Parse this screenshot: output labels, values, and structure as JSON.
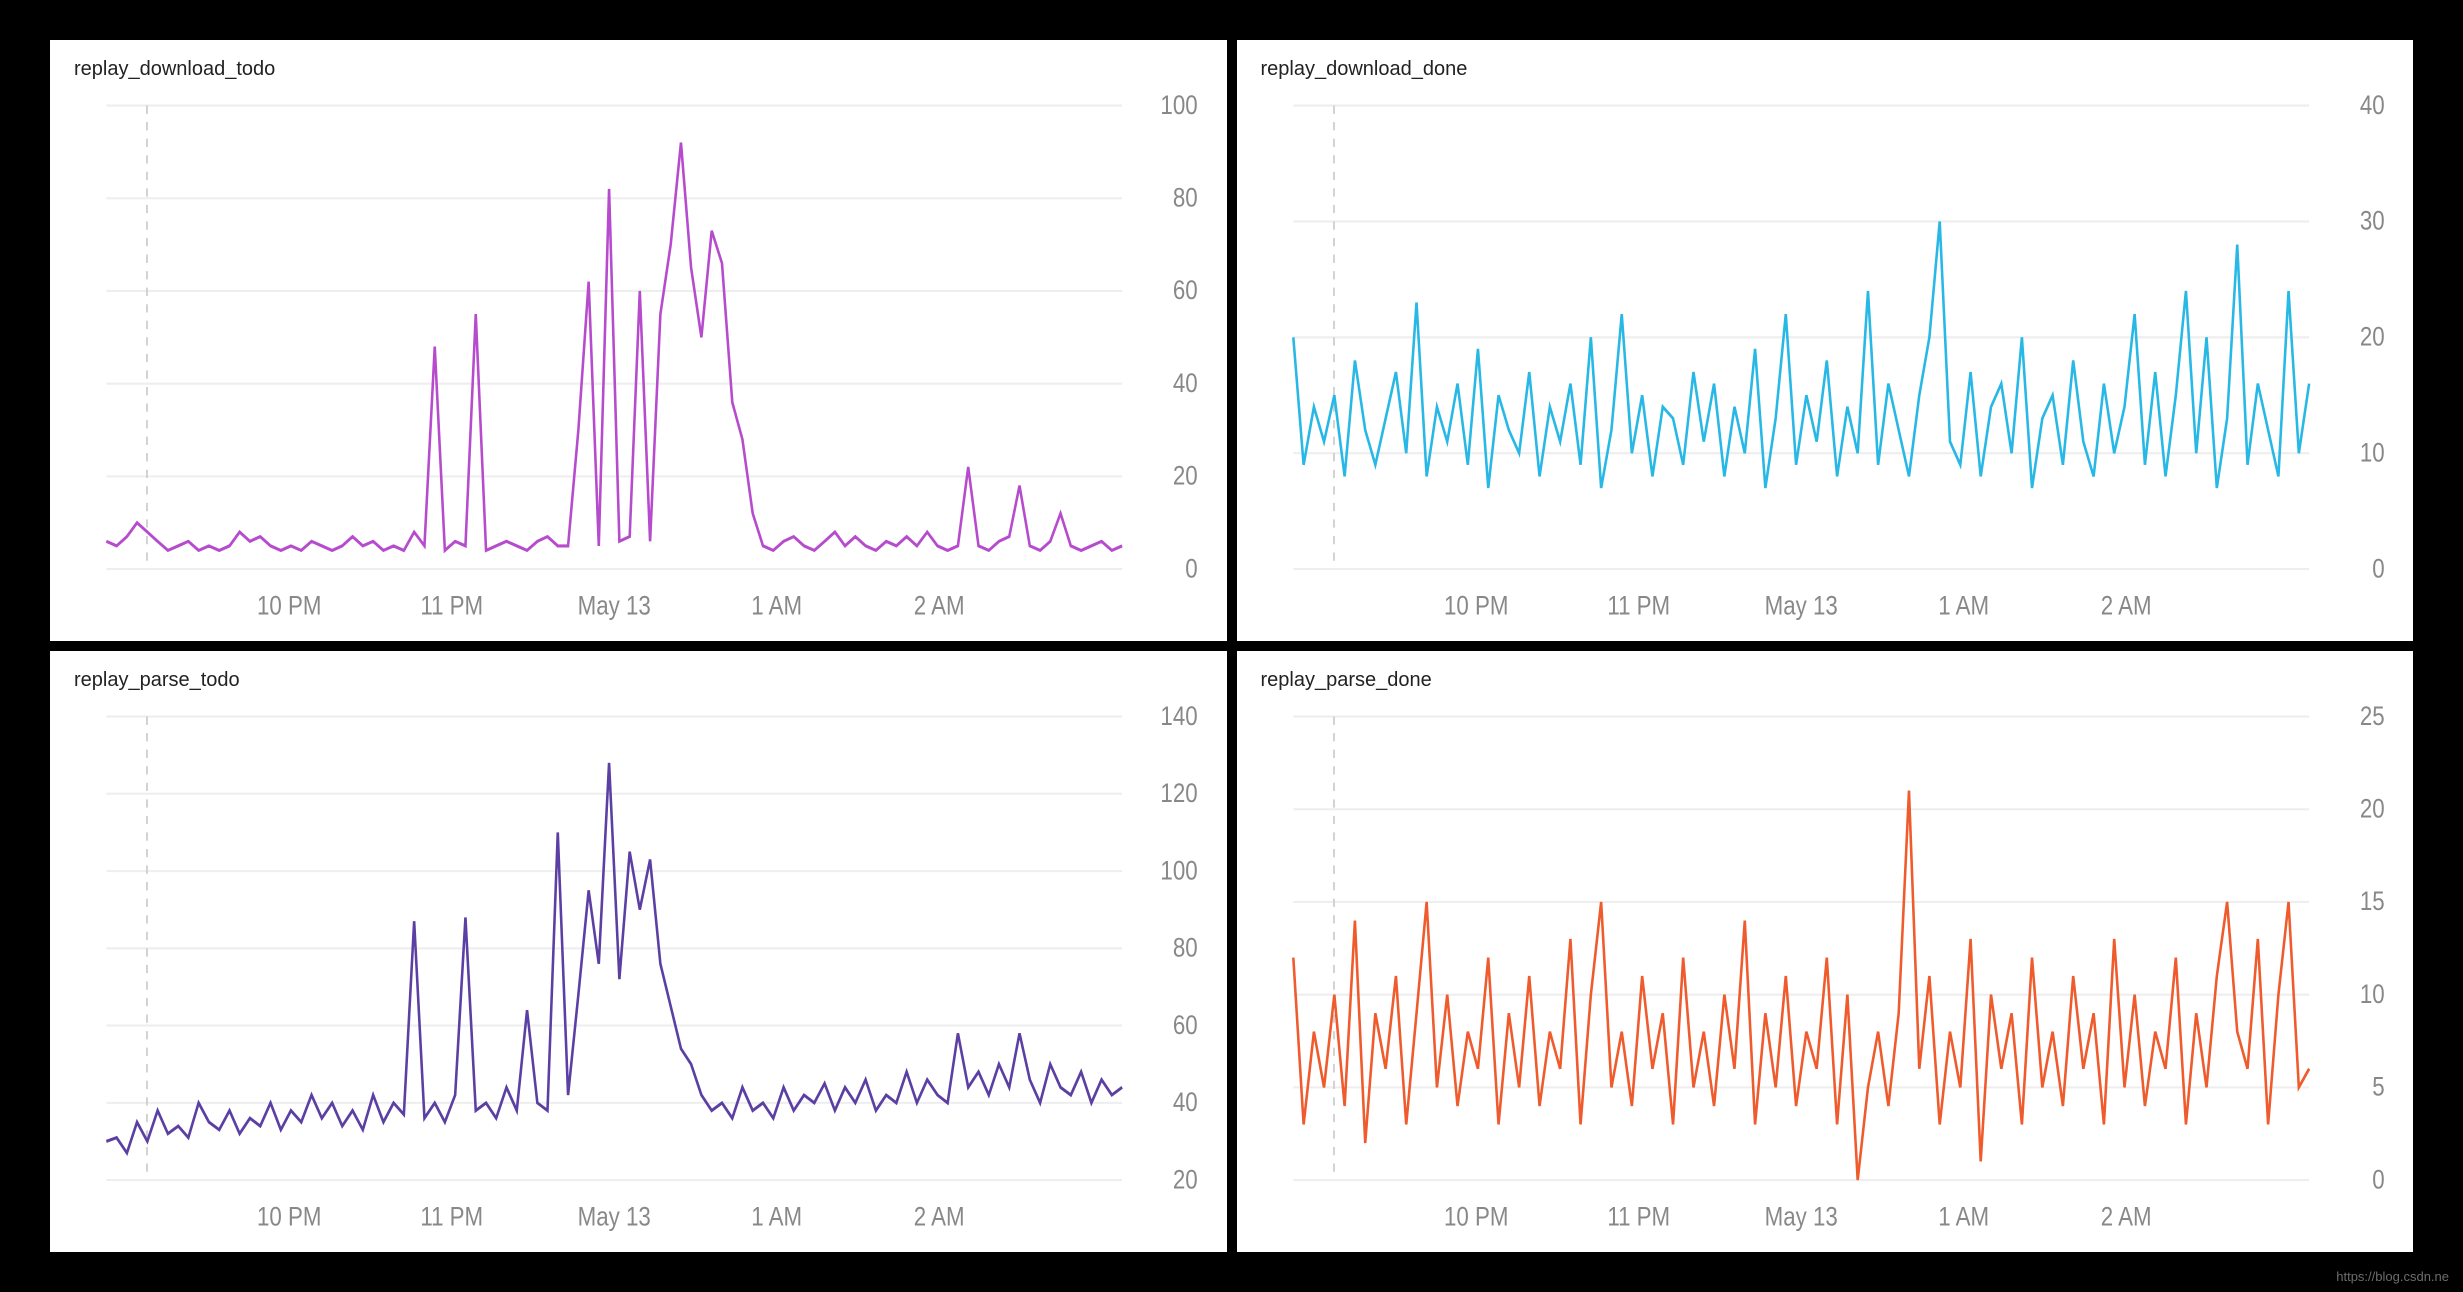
{
  "watermark": "https://blog.csdn.ne",
  "x_ticks": [
    "10 PM",
    "11 PM",
    "May 13",
    "1 AM",
    "2 AM"
  ],
  "panels": [
    {
      "id": "dl-todo",
      "title": "replay_download_todo",
      "color": "#b74bcd",
      "yticks": [
        0,
        20,
        40,
        60,
        80,
        100
      ],
      "ymin": 0,
      "ymax": 100,
      "kind": "spiky"
    },
    {
      "id": "dl-done",
      "title": "replay_download_done",
      "color": "#28b8e6",
      "yticks": [
        0,
        10,
        20,
        30,
        40
      ],
      "ymin": 0,
      "ymax": 40,
      "kind": "noisy1"
    },
    {
      "id": "parse-todo",
      "title": "replay_parse_todo",
      "color": "#5b3fa3",
      "yticks": [
        20,
        40,
        60,
        80,
        100,
        120,
        140
      ],
      "ymin": 20,
      "ymax": 140,
      "kind": "spiky2"
    },
    {
      "id": "parse-done",
      "title": "replay_parse_done",
      "color": "#ef5b2c",
      "yticks": [
        0,
        5,
        10,
        15,
        20,
        25
      ],
      "ymin": 0,
      "ymax": 25,
      "kind": "noisy2"
    }
  ],
  "chart_data": [
    {
      "type": "line",
      "title": "replay_download_todo",
      "xlabel": "",
      "ylabel": "",
      "ylim": [
        0,
        100
      ],
      "x_ticks": [
        "10 PM",
        "11 PM",
        "May 13",
        "1 AM",
        "2 AM"
      ],
      "series": [
        {
          "name": "replay_download_todo",
          "color": "#b74bcd",
          "values": [
            6,
            5,
            7,
            10,
            8,
            6,
            4,
            5,
            6,
            4,
            5,
            4,
            5,
            8,
            6,
            7,
            5,
            4,
            5,
            4,
            6,
            5,
            4,
            5,
            7,
            5,
            6,
            4,
            5,
            4,
            8,
            5,
            48,
            4,
            6,
            5,
            55,
            4,
            5,
            6,
            5,
            4,
            6,
            7,
            5,
            5,
            30,
            62,
            5,
            82,
            6,
            7,
            60,
            6,
            55,
            70,
            92,
            65,
            50,
            73,
            66,
            36,
            28,
            12,
            5,
            4,
            6,
            7,
            5,
            4,
            6,
            8,
            5,
            7,
            5,
            4,
            6,
            5,
            7,
            5,
            8,
            5,
            4,
            5,
            22,
            5,
            4,
            6,
            7,
            18,
            5,
            4,
            6,
            12,
            5,
            4,
            5,
            6,
            4,
            5
          ]
        }
      ]
    },
    {
      "type": "line",
      "title": "replay_download_done",
      "xlabel": "",
      "ylabel": "",
      "ylim": [
        0,
        40
      ],
      "x_ticks": [
        "10 PM",
        "11 PM",
        "May 13",
        "1 AM",
        "2 AM"
      ],
      "series": [
        {
          "name": "replay_download_done",
          "color": "#28b8e6",
          "values": [
            20,
            9,
            14,
            11,
            15,
            8,
            18,
            12,
            9,
            13,
            17,
            10,
            23,
            8,
            14,
            11,
            16,
            9,
            19,
            7,
            15,
            12,
            10,
            17,
            8,
            14,
            11,
            16,
            9,
            20,
            7,
            12,
            22,
            10,
            15,
            8,
            14,
            13,
            9,
            17,
            11,
            16,
            8,
            14,
            10,
            19,
            7,
            13,
            22,
            9,
            15,
            11,
            18,
            8,
            14,
            10,
            24,
            9,
            16,
            12,
            8,
            15,
            20,
            30,
            11,
            9,
            17,
            8,
            14,
            16,
            10,
            20,
            7,
            13,
            15,
            9,
            18,
            11,
            8,
            16,
            10,
            14,
            22,
            9,
            17,
            8,
            15,
            24,
            10,
            20,
            7,
            13,
            28,
            9,
            16,
            12,
            8,
            24,
            10,
            16
          ]
        }
      ]
    },
    {
      "type": "line",
      "title": "replay_parse_todo",
      "xlabel": "",
      "ylabel": "",
      "ylim": [
        20,
        140
      ],
      "x_ticks": [
        "10 PM",
        "11 PM",
        "May 13",
        "1 AM",
        "2 AM"
      ],
      "series": [
        {
          "name": "replay_parse_todo",
          "color": "#5b3fa3",
          "values": [
            30,
            31,
            27,
            35,
            30,
            38,
            32,
            34,
            31,
            40,
            35,
            33,
            38,
            32,
            36,
            34,
            40,
            33,
            38,
            35,
            42,
            36,
            40,
            34,
            38,
            33,
            42,
            35,
            40,
            37,
            87,
            36,
            40,
            35,
            42,
            88,
            38,
            40,
            36,
            44,
            38,
            64,
            40,
            38,
            110,
            42,
            68,
            95,
            76,
            128,
            72,
            105,
            90,
            103,
            76,
            65,
            54,
            50,
            42,
            38,
            40,
            36,
            44,
            38,
            40,
            36,
            44,
            38,
            42,
            40,
            45,
            38,
            44,
            40,
            46,
            38,
            42,
            40,
            48,
            40,
            46,
            42,
            40,
            58,
            44,
            48,
            42,
            50,
            44,
            58,
            46,
            40,
            50,
            44,
            42,
            48,
            40,
            46,
            42,
            44
          ]
        }
      ]
    },
    {
      "type": "line",
      "title": "replay_parse_done",
      "xlabel": "",
      "ylabel": "",
      "ylim": [
        0,
        25
      ],
      "x_ticks": [
        "10 PM",
        "11 PM",
        "May 13",
        "1 AM",
        "2 AM"
      ],
      "series": [
        {
          "name": "replay_parse_done",
          "color": "#ef5b2c",
          "values": [
            12,
            3,
            8,
            5,
            10,
            4,
            14,
            2,
            9,
            6,
            11,
            3,
            9,
            15,
            5,
            10,
            4,
            8,
            6,
            12,
            3,
            9,
            5,
            11,
            4,
            8,
            6,
            13,
            3,
            10,
            15,
            5,
            8,
            4,
            11,
            6,
            9,
            3,
            12,
            5,
            8,
            4,
            10,
            6,
            14,
            3,
            9,
            5,
            11,
            4,
            8,
            6,
            12,
            3,
            10,
            0,
            5,
            8,
            4,
            9,
            21,
            6,
            11,
            3,
            8,
            5,
            13,
            1,
            10,
            6,
            9,
            3,
            12,
            5,
            8,
            4,
            11,
            6,
            9,
            3,
            13,
            5,
            10,
            4,
            8,
            6,
            12,
            3,
            9,
            5,
            11,
            15,
            8,
            6,
            13,
            3,
            10,
            15,
            5,
            6
          ]
        }
      ]
    }
  ]
}
